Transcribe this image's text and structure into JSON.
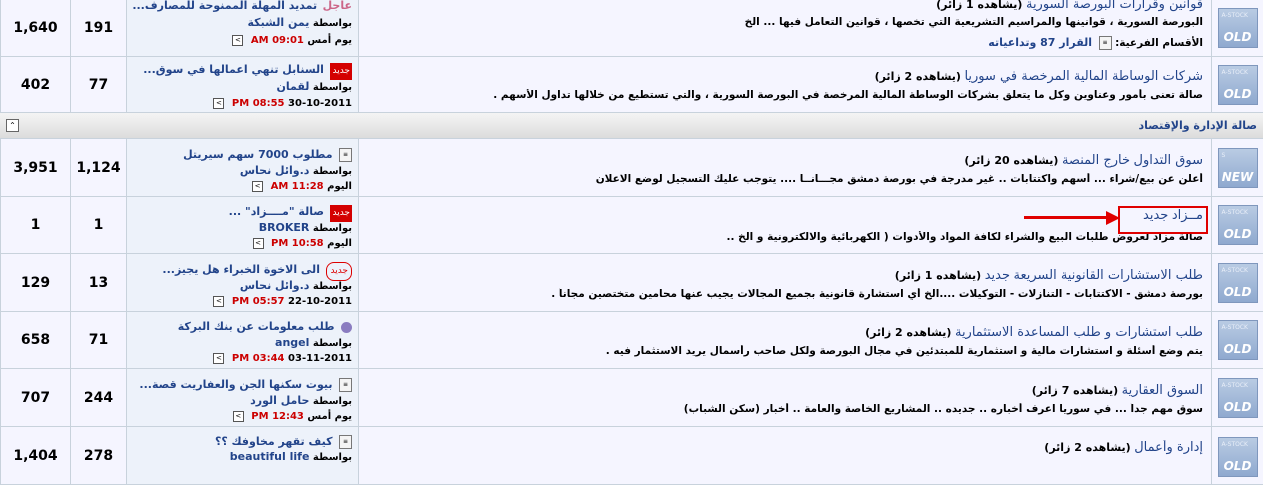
{
  "rows": [
    {
      "posts": "1,640",
      "threads": "191",
      "last_title": "تمديد المهلة الممنوحة للمصارف...",
      "last_badge": "عاجل",
      "by_label": "بواسطة",
      "last_user": "يمن الشبكة",
      "last_date": "يوم أمس",
      "last_time": "09:01 AM",
      "forum_title": "قوانين وقرارات البورصة السورية",
      "forum_viewers": "(يشاهده 1 زائر)",
      "forum_desc": "البورصة السورية ، قوانينها والمراسيم التشريعية التي تخصها ، قوانين التعامل فيها ... الخ",
      "sub_label": "الأقسام الفرعية:",
      "sub_link": "القرار 87 وتداعياته",
      "icon_top": "A-STOCK",
      "icon_text": "OLD"
    },
    {
      "posts": "402",
      "threads": "77",
      "last_title": "السنابل تنهي اعمالها في سوق...",
      "last_badge": "جديد",
      "by_label": "بواسطة",
      "last_user": "لقمان",
      "last_date": "30-10-2011",
      "last_time": "08:55 PM",
      "forum_title": "شركات الوساطة المالية المرخصة في سوريا",
      "forum_viewers": "(يشاهده 2 زائر)",
      "forum_desc": "صالة تعنى بأمور وعناوين وكل ما يتعلق بشركات الوساطة المالية المرخصة في البورصة السورية ، والتي تستطيع من خلالها تداول الأسهم .",
      "icon_top": "A-STOCK",
      "icon_text": "OLD"
    }
  ],
  "category": {
    "title": "صالة الإدارة والإقتصاد",
    "collapse_symbol": "⌃"
  },
  "rows2": [
    {
      "posts": "3,951",
      "threads": "1,124",
      "last_title": "مطلوب 7000 سهم سيريتل",
      "by_label": "بواسطة",
      "last_user": "د.وائل نحاس",
      "last_date": "اليوم",
      "last_time": "11:28 AM",
      "forum_title_a": "سوق التداول",
      "forum_title_b": "خارج المنصة",
      "forum_viewers": "(يشاهده 20 زائر)",
      "forum_desc": "أعلن عن بيع/شراء ... أسهم واكتتابات .. غير مدرجة في بورصة دمشق مجـــانــا .... يتوجب عليك التسجيل لوضع الاعلان",
      "icon_top": "S",
      "icon_text": "NEW"
    },
    {
      "posts": "1",
      "threads": "1",
      "last_title": "صالة \"مــــزاد\" ...",
      "last_badge": "جديد",
      "by_label": "بواسطة",
      "last_user": "BROKER",
      "last_date": "اليوم",
      "last_time": "10:58 PM",
      "forum_title_a": "مــزاد",
      "forum_title_b": "جديد",
      "forum_desc": "صالة مزاد لعروض طلبات البيع والشراء لكافة المواد والأدوات ( الكهربائية والالكترونية و الخ ..",
      "icon_top": "A-STOCK",
      "icon_text": "OLD"
    },
    {
      "posts": "129",
      "threads": "13",
      "last_title": "الى الاخوة الخبراء هل يجيز...",
      "last_badge": "جديد",
      "by_label": "بواسطة",
      "last_user": "د.وائل نحاس",
      "last_date": "22-10-2011",
      "last_time": "05:57 PM",
      "forum_title_a": "طلب الاستشارات القانونية السريعة",
      "forum_title_b": "جديد",
      "forum_viewers": "(يشاهده 1 زائر)",
      "forum_desc": "بورصة دمشق - الاكتتابات - التنازلات - التوكيلات ....الخ أي استشارة قانونية بجميع المجالات يجيب عنها محامين متختصين مجاناً .",
      "icon_top": "A-STOCK",
      "icon_text": "OLD"
    },
    {
      "posts": "658",
      "threads": "71",
      "last_title": "طلب معلومات عن بنك البركة",
      "by_label": "بواسطة",
      "last_user": "angel",
      "last_date": "03-11-2011",
      "last_time": "03:44 PM",
      "forum_title_a": "طلب استشارات و طلب المساعدة الاستثمارية",
      "forum_viewers": "(يشاهده 2 زائر)",
      "forum_desc": "يتم وضع أسئلة و استشارات مالية و استثمارية للمبتدئين في مجال البورصة ولكل صاحب رأسمال يريد الاستثمار فيه .",
      "icon_top": "A-STOCK",
      "icon_text": "OLD"
    },
    {
      "posts": "707",
      "threads": "244",
      "last_title": "بيوت سكنها الجن والعفاريت قصة...",
      "by_label": "بواسطة",
      "last_user": "حامل الورد",
      "last_date": "يوم أمس",
      "last_time": "12:43 PM",
      "forum_title_a": "السوق العقارية",
      "forum_viewers": "(يشاهده 7 زائر)",
      "forum_desc": "سوق مهم جداً ... في سوريا اعرف أخباره .. جديده .. المشاريع الخاصة والعامة .. أخبار (سكن الشباب)",
      "icon_top": "A-STOCK",
      "icon_text": "OLD"
    },
    {
      "posts": "1,404",
      "threads": "278",
      "last_title": "كيف تقهر مخاوفك ؟؟",
      "by_label": "بواسطة",
      "last_user": "beautiful life",
      "forum_title_a": "إدارة وأعمال",
      "forum_viewers": "(يشاهده 2 زائر)",
      "icon_top": "A-STOCK",
      "icon_text": "OLD"
    }
  ]
}
